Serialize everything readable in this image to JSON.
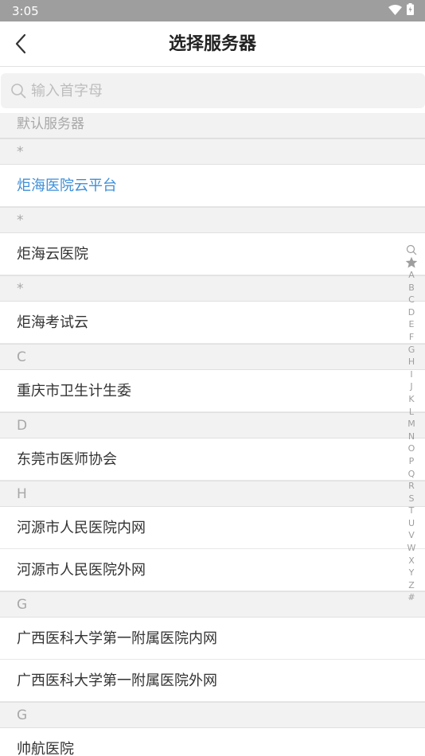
{
  "status_bar": {
    "time": "3:05"
  },
  "header": {
    "title": "选择服务器"
  },
  "search": {
    "placeholder": "输入首字母",
    "value": ""
  },
  "default_section": {
    "label": "默认服务器"
  },
  "groups": [
    {
      "header": "*",
      "items": [
        {
          "label": "炬海医院云平台",
          "selected": true
        }
      ]
    },
    {
      "header": "*",
      "items": [
        {
          "label": "炬海云医院"
        }
      ]
    },
    {
      "header": "*",
      "items": [
        {
          "label": "炬海考试云"
        }
      ]
    },
    {
      "header": "C",
      "items": [
        {
          "label": "重庆市卫生计生委"
        }
      ]
    },
    {
      "header": "D",
      "items": [
        {
          "label": "东莞市医师协会"
        }
      ]
    },
    {
      "header": "H",
      "items": [
        {
          "label": "河源市人民医院内网"
        },
        {
          "label": "河源市人民医院外网"
        }
      ]
    },
    {
      "header": "G",
      "items": [
        {
          "label": "广西医科大学第一附属医院内网"
        },
        {
          "label": "广西医科大学第一附属医院外网"
        }
      ]
    },
    {
      "header": "G",
      "items": [
        {
          "label": "帅航医院"
        }
      ]
    }
  ],
  "index_letters": [
    "A",
    "B",
    "C",
    "D",
    "E",
    "F",
    "G",
    "H",
    "I",
    "J",
    "K",
    "L",
    "M",
    "N",
    "O",
    "P",
    "Q",
    "R",
    "S",
    "T",
    "U",
    "V",
    "W",
    "X",
    "Y",
    "Z",
    "#"
  ],
  "colors": {
    "accent": "#3d8fd8",
    "status_bar": "#9e9e9e",
    "section_bg": "#f2f2f2"
  }
}
